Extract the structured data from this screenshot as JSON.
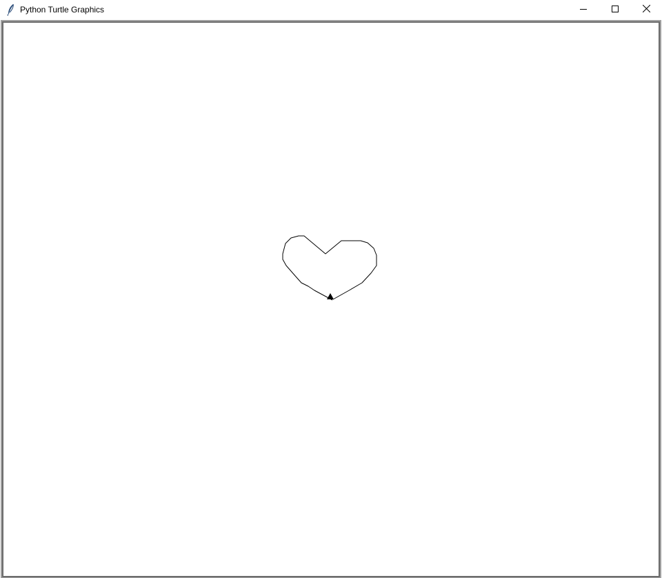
{
  "window": {
    "title": "Python Turtle Graphics",
    "icon": "feather-icon",
    "controls": {
      "minimize_icon": "minimize-icon",
      "maximize_icon": "maximize-icon",
      "close_icon": "close-icon"
    }
  },
  "canvas": {
    "background": "#ffffff",
    "pen_color": "#000000",
    "drawing": "heart-outline",
    "turtle_cursor": "arrow-triangle"
  }
}
